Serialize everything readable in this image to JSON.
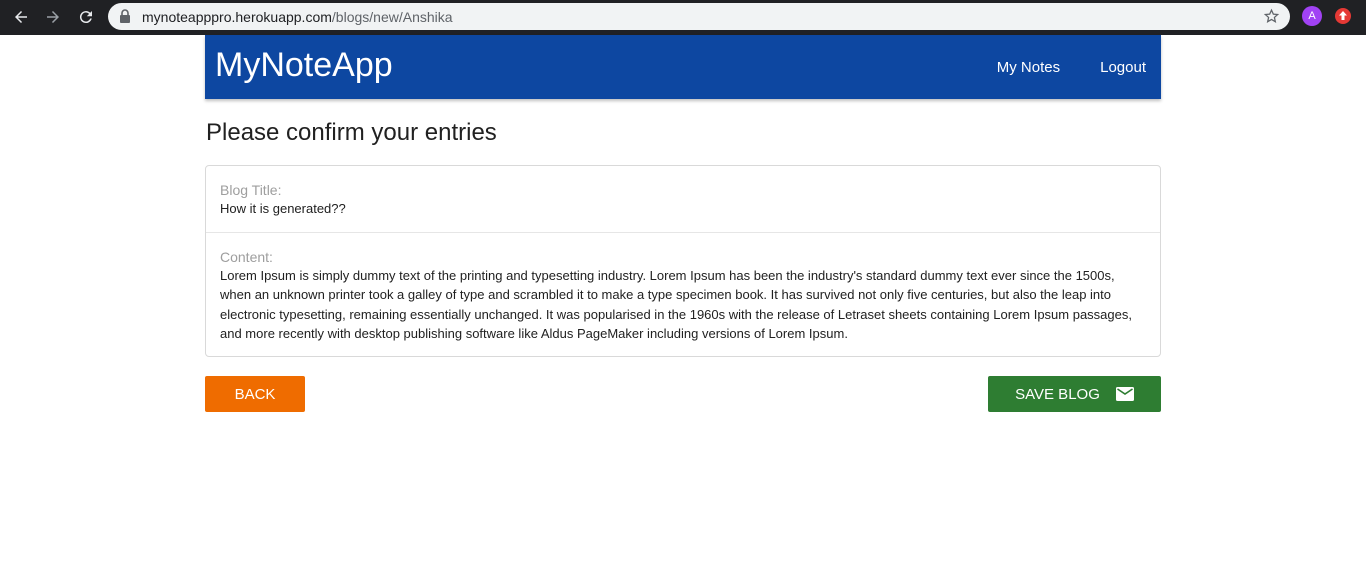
{
  "browser": {
    "url_host": "mynoteapppro.herokuapp.com",
    "url_path": "/blogs/new/Anshika",
    "profile_initial": "A"
  },
  "navbar": {
    "brand": "MyNoteApp",
    "links": [
      "My Notes",
      "Logout"
    ],
    "color": "#0d47a1"
  },
  "page": {
    "title": "Please confirm your entries"
  },
  "entry": {
    "title_label": "Blog Title:",
    "title_value": "How it is generated??",
    "content_label": "Content:",
    "content_value": "Lorem Ipsum is simply dummy text of the printing and typesetting industry. Lorem Ipsum has been the industry's standard dummy text ever since the 1500s, when an unknown printer took a galley of type and scrambled it to make a type specimen book. It has survived not only five centuries, but also the leap into electronic typesetting, remaining essentially unchanged. It was popularised in the 1960s with the release of Letraset sheets containing Lorem Ipsum passages, and more recently with desktop publishing software like Aldus PageMaker including versions of Lorem Ipsum."
  },
  "actions": {
    "back_label": "Back",
    "save_label": "Save Blog",
    "save_icon": "mail-icon",
    "back_color": "#ef6c00",
    "save_color": "#2e7d32"
  }
}
